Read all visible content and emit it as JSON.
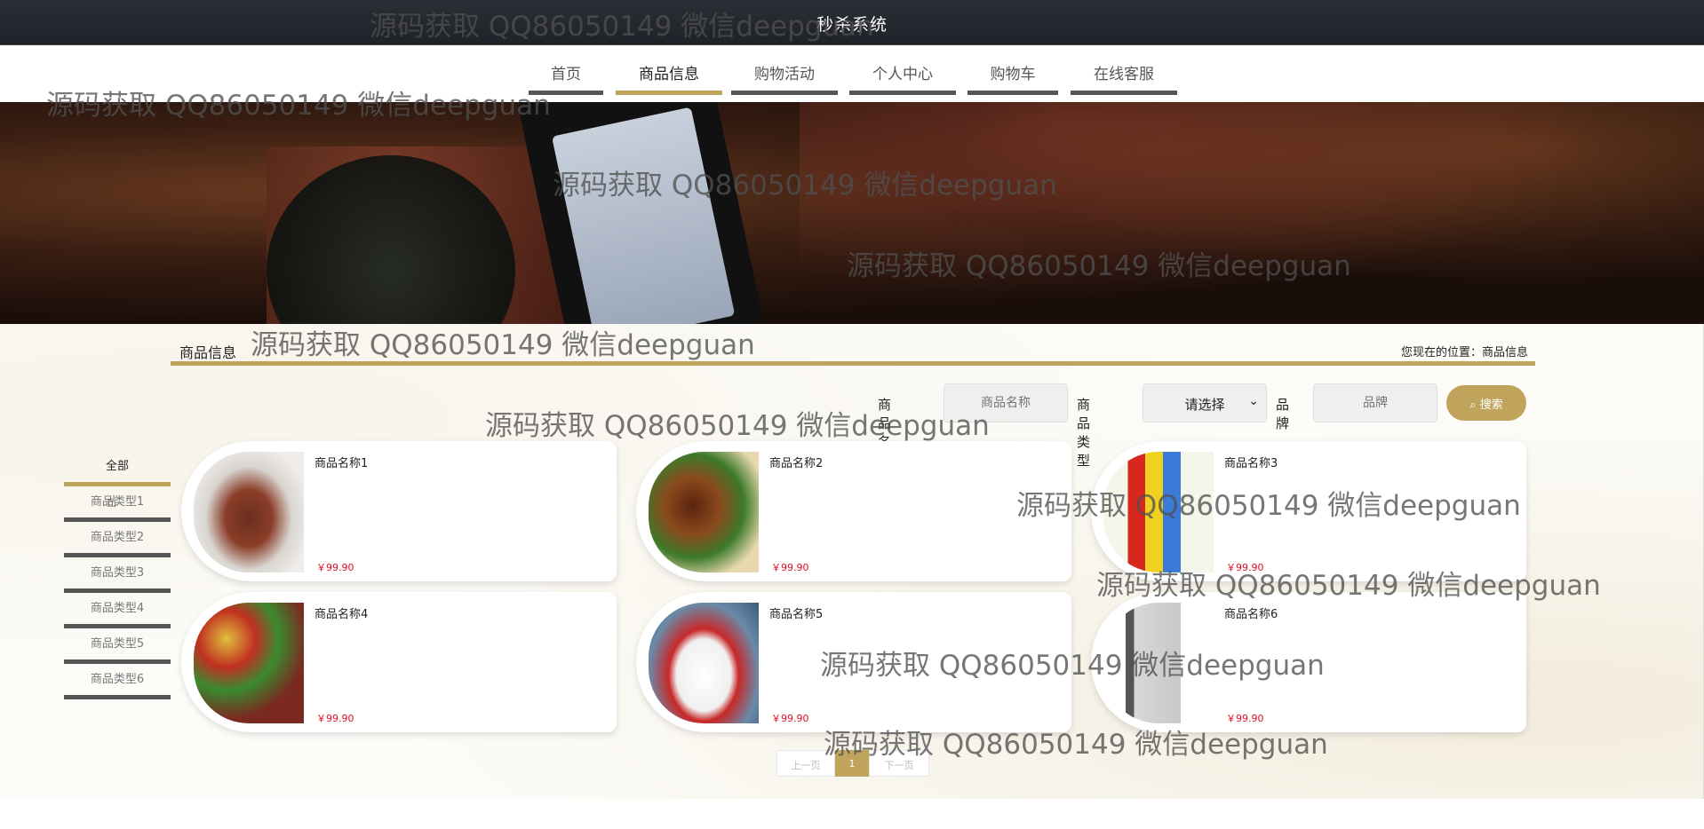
{
  "app_title": "秒杀系统",
  "nav": [
    "首页",
    "商品信息",
    "购物活动",
    "个人中心",
    "购物车",
    "在线客服"
  ],
  "section": {
    "title": "商品信息",
    "breadcrumb": "您现在的位置：商品信息"
  },
  "search": {
    "name_label": "商品名称",
    "name_placeholder": "商品名称",
    "type_label": "商品类型",
    "type_value": "请选择",
    "brand_label": "品牌",
    "brand_placeholder": "品牌",
    "button": "搜索"
  },
  "categories": [
    "全部",
    "商品类型1",
    "商品类型2",
    "商品类型3",
    "商品类型4",
    "商品类型5",
    "商品类型6"
  ],
  "products": [
    {
      "name": "商品名称1",
      "price": "￥99.90"
    },
    {
      "name": "商品名称2",
      "price": "￥99.90"
    },
    {
      "name": "商品名称3",
      "price": "￥99.90"
    },
    {
      "name": "商品名称4",
      "price": "￥99.90"
    },
    {
      "name": "商品名称5",
      "price": "￥99.90"
    },
    {
      "name": "商品名称6",
      "price": "￥99.90"
    }
  ],
  "pager": {
    "prev": "上一页",
    "current": "1",
    "next": "下一页"
  },
  "watermark": "源码获取 QQ86050149 微信deepguan",
  "colors": {
    "accent": "#c1a45b",
    "topbar": "#24272d",
    "price": "#dd1122"
  }
}
